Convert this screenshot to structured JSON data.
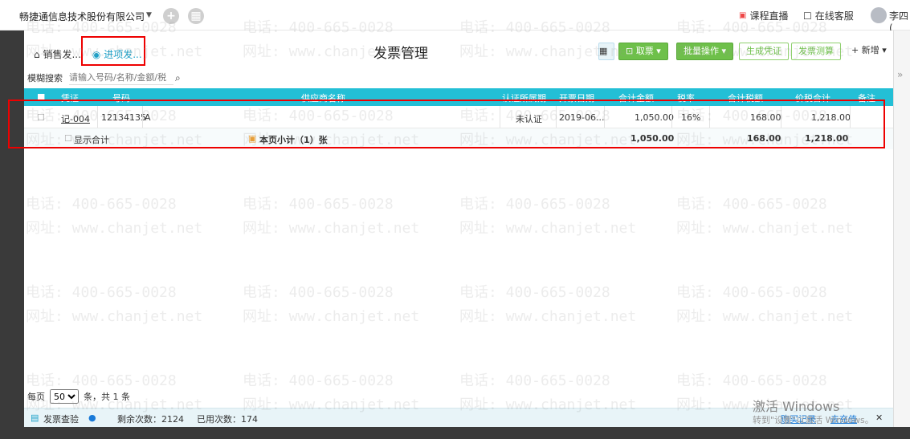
{
  "header": {
    "company": "畅捷通信息技术股份有限公司",
    "live_course": "课程直播",
    "online_service": "在线客服",
    "user": "李四("
  },
  "tabs": [
    {
      "label": "销售发..."
    },
    {
      "label": "进项发..."
    }
  ],
  "page_title": "发票管理",
  "toolbar": {
    "fetch_label": "取票",
    "batch_label": "批量操作",
    "voucher_label": "生成凭证",
    "calc_label": "发票测算",
    "add_label": "+ 新增"
  },
  "search": {
    "label": "模糊搜索",
    "placeholder": "请输入号码/名称/金额/税"
  },
  "table": {
    "headers": [
      "凭证",
      "号码",
      "供应商名称",
      "认证所属期",
      "开票日期",
      "合计金额",
      "税率",
      "合计税额",
      "价税合计",
      "备注"
    ],
    "rows": [
      {
        "voucher": "记-004",
        "number": "12134135",
        "supplier": "A",
        "auth_period": "未认证",
        "date": "2019-06...",
        "amount": "1,050.00",
        "tax_rate": "16%",
        "tax": "168.00",
        "total": "1,218.00",
        "note": ""
      }
    ],
    "subtotal": {
      "show_total_label": "显示合计",
      "label": "本页小计（1）张",
      "amount": "1,050.00",
      "tax": "168.00",
      "total": "1,218.00"
    }
  },
  "pager": {
    "per_page_label": "每页",
    "per_page_value": "50",
    "summary": "条，共 1 条"
  },
  "footer": {
    "check_label": "发票查验",
    "remaining": "剩余次数：2124",
    "used": "已用次数：174",
    "buy_record": "购买记录",
    "recharge": "去充值"
  },
  "watermark": {
    "phone": "电话: 400-665-0028",
    "site": "网址: www.chanjet.net"
  },
  "windows_activation": {
    "title": "激活 Windows",
    "sub": "转到\"设置\"以激活 Windows。"
  },
  "colors": {
    "accent": "#23bfd6",
    "green": "#6ec04a",
    "highlight": "#ee0000"
  }
}
